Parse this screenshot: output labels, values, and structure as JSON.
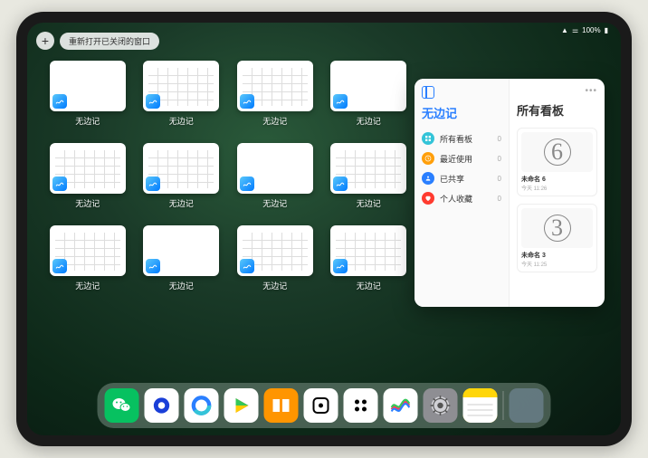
{
  "status": {
    "battery": "100%",
    "wifi": "wifi-icon",
    "signal": "signal-icon"
  },
  "topbar": {
    "add_label": "+",
    "reopen_label": "重新打开已关闭的窗口"
  },
  "windows": {
    "app_label": "无边记",
    "tiles": [
      {
        "style": "blank"
      },
      {
        "style": "calendar"
      },
      {
        "style": "calendar"
      },
      {
        "style": "blank"
      },
      {
        "style": "calendar"
      },
      {
        "style": "calendar"
      },
      {
        "style": "blank"
      },
      {
        "style": "calendar"
      },
      {
        "style": "calendar"
      },
      {
        "style": "blank"
      },
      {
        "style": "calendar"
      },
      {
        "style": "calendar"
      }
    ]
  },
  "stage": {
    "left_title": "无边记",
    "right_title": "所有看板",
    "nav": [
      {
        "icon": "grid",
        "color": "#34c4d8",
        "label": "所有看板",
        "count": "0"
      },
      {
        "icon": "clock",
        "color": "#ff9f0a",
        "label": "最近使用",
        "count": "0"
      },
      {
        "icon": "share",
        "color": "#2a7fff",
        "label": "已共享",
        "count": "0"
      },
      {
        "icon": "heart",
        "color": "#ff3b30",
        "label": "个人收藏",
        "count": "0"
      }
    ],
    "boards": [
      {
        "glyph": "6",
        "name": "未命名 6",
        "meta": "今天 11:26"
      },
      {
        "glyph": "3",
        "name": "未命名 3",
        "meta": "今天 11:25"
      }
    ]
  },
  "dock": {
    "apps": [
      {
        "name": "wechat",
        "bg": "#07c160",
        "glyph": "wechat"
      },
      {
        "name": "browser1",
        "bg": "#ffffff",
        "glyph": "ring-blue"
      },
      {
        "name": "browser2",
        "bg": "#ffffff",
        "glyph": "ring-cyan"
      },
      {
        "name": "play",
        "bg": "#ffffff",
        "glyph": "play"
      },
      {
        "name": "books",
        "bg": "#ff9500",
        "glyph": "books"
      },
      {
        "name": "dice",
        "bg": "#ffffff",
        "glyph": "dice"
      },
      {
        "name": "dots",
        "bg": "#ffffff",
        "glyph": "dots4"
      },
      {
        "name": "freeform",
        "bg": "#ffffff",
        "glyph": "scribble"
      },
      {
        "name": "settings",
        "bg": "#8e8e93",
        "glyph": "gear"
      },
      {
        "name": "notes",
        "bg": "#ffd60a",
        "glyph": "notes"
      }
    ],
    "folder": [
      "#ff9500",
      "#34c759",
      "#007aff",
      "#00c7be"
    ]
  }
}
